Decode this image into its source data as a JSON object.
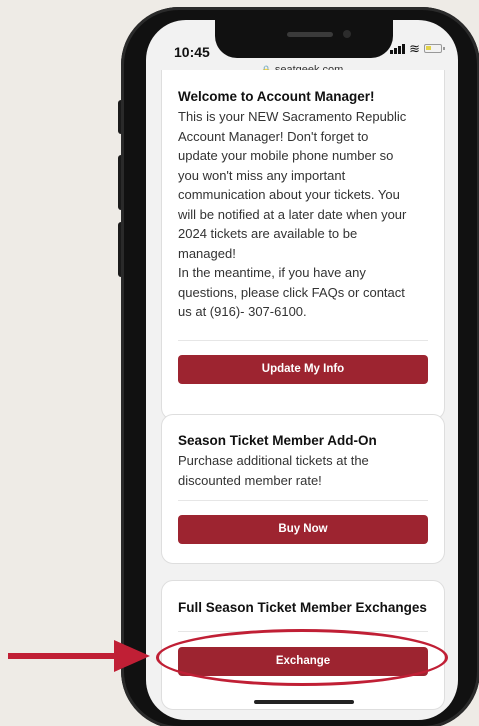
{
  "status_bar": {
    "time": "10:45"
  },
  "browser": {
    "url": "seatgeek.com"
  },
  "cards": [
    {
      "title": "Welcome to Account Manager!",
      "body_lines": [
        "This is your NEW Sacramento Republic",
        "Account Manager! Don't forget to",
        "update your mobile phone number so",
        "you won't miss any important",
        "communication about your tickets. You",
        "will be notified at a later date when your",
        "2024 tickets are available to be",
        "managed!",
        "In the meantime, if you have any",
        "questions, please click FAQs or contact",
        "us at (916)- 307-6100."
      ],
      "button_label": "Update My Info"
    },
    {
      "title": "Season Ticket Member Add-On",
      "body_lines": [
        "Purchase additional tickets at the",
        "discounted member rate!"
      ],
      "button_label": "Buy Now"
    },
    {
      "title": "Full Season Ticket Member Exchanges",
      "body_lines": [],
      "button_label": "Exchange"
    }
  ],
  "colors": {
    "button": "#9d2430",
    "annotation": "#c01f35",
    "background": "#eeebe6"
  },
  "icons": [
    "lock-icon",
    "signal-icon",
    "wifi-icon",
    "battery-icon",
    "arrow-annotation",
    "highlight-ring-annotation"
  ]
}
